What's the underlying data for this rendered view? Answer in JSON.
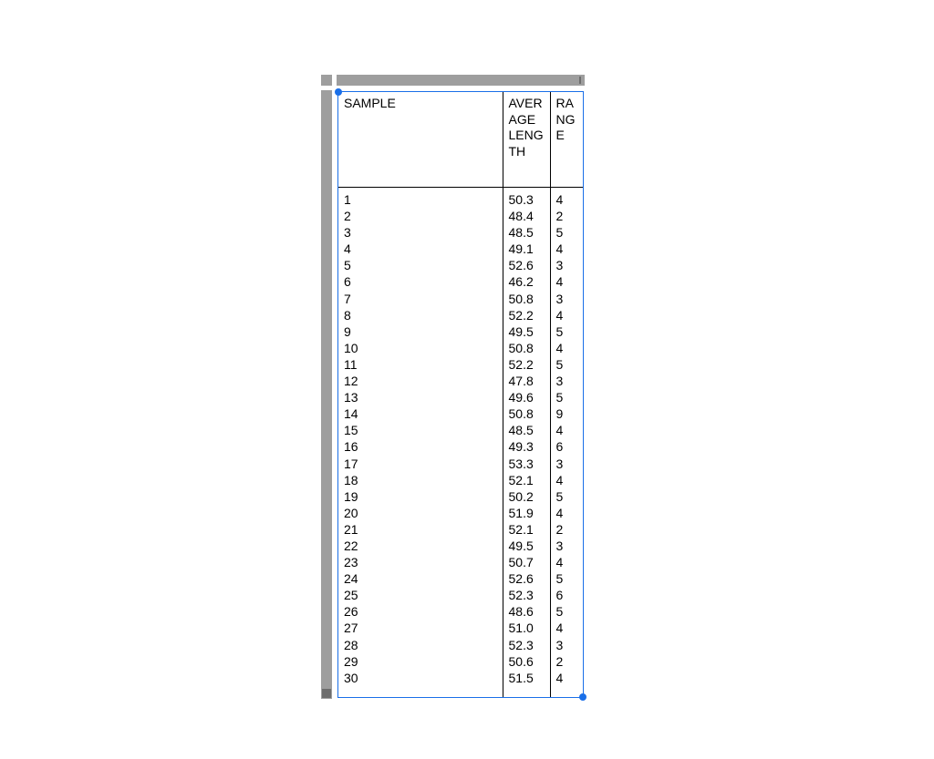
{
  "chart_data": {
    "type": "table",
    "title": "",
    "columns": [
      "SAMPLE",
      "AVERAGE LENGTH",
      "RANGE"
    ],
    "rows": [
      {
        "sample": "1",
        "avg": "50.3",
        "range": "4"
      },
      {
        "sample": "2",
        "avg": "48.4",
        "range": "2"
      },
      {
        "sample": "3",
        "avg": "48.5",
        "range": "5"
      },
      {
        "sample": "4",
        "avg": "49.1",
        "range": "4"
      },
      {
        "sample": "5",
        "avg": "52.6",
        "range": "3"
      },
      {
        "sample": "6",
        "avg": "46.2",
        "range": "4"
      },
      {
        "sample": "7",
        "avg": "50.8",
        "range": "3"
      },
      {
        "sample": "8",
        "avg": "52.2",
        "range": "4"
      },
      {
        "sample": "9",
        "avg": "49.5",
        "range": "5"
      },
      {
        "sample": "10",
        "avg": "50.8",
        "range": "4"
      },
      {
        "sample": "11",
        "avg": "52.2",
        "range": "5"
      },
      {
        "sample": "12",
        "avg": "47.8",
        "range": "3"
      },
      {
        "sample": "13",
        "avg": "49.6",
        "range": "5"
      },
      {
        "sample": "14",
        "avg": "50.8",
        "range": "9"
      },
      {
        "sample": "15",
        "avg": "48.5",
        "range": "4"
      },
      {
        "sample": "16",
        "avg": "49.3",
        "range": "6"
      },
      {
        "sample": "17",
        "avg": "53.3",
        "range": "3"
      },
      {
        "sample": "18",
        "avg": "52.1",
        "range": "4"
      },
      {
        "sample": "19",
        "avg": "50.2",
        "range": "5"
      },
      {
        "sample": "20",
        "avg": "51.9",
        "range": "4"
      },
      {
        "sample": "21",
        "avg": "52.1",
        "range": "2"
      },
      {
        "sample": "22",
        "avg": "49.5",
        "range": "3"
      },
      {
        "sample": "23",
        "avg": "50.7",
        "range": "4"
      },
      {
        "sample": "24",
        "avg": "52.6",
        "range": "5"
      },
      {
        "sample": "25",
        "avg": "52.3",
        "range": "6"
      },
      {
        "sample": "26",
        "avg": "48.6",
        "range": "5"
      },
      {
        "sample": "27",
        "avg": "51.0",
        "range": "4"
      },
      {
        "sample": "28",
        "avg": "52.3",
        "range": "3"
      },
      {
        "sample": "29",
        "avg": "50.6",
        "range": "2"
      },
      {
        "sample": "30",
        "avg": "51.5",
        "range": "4"
      }
    ]
  }
}
